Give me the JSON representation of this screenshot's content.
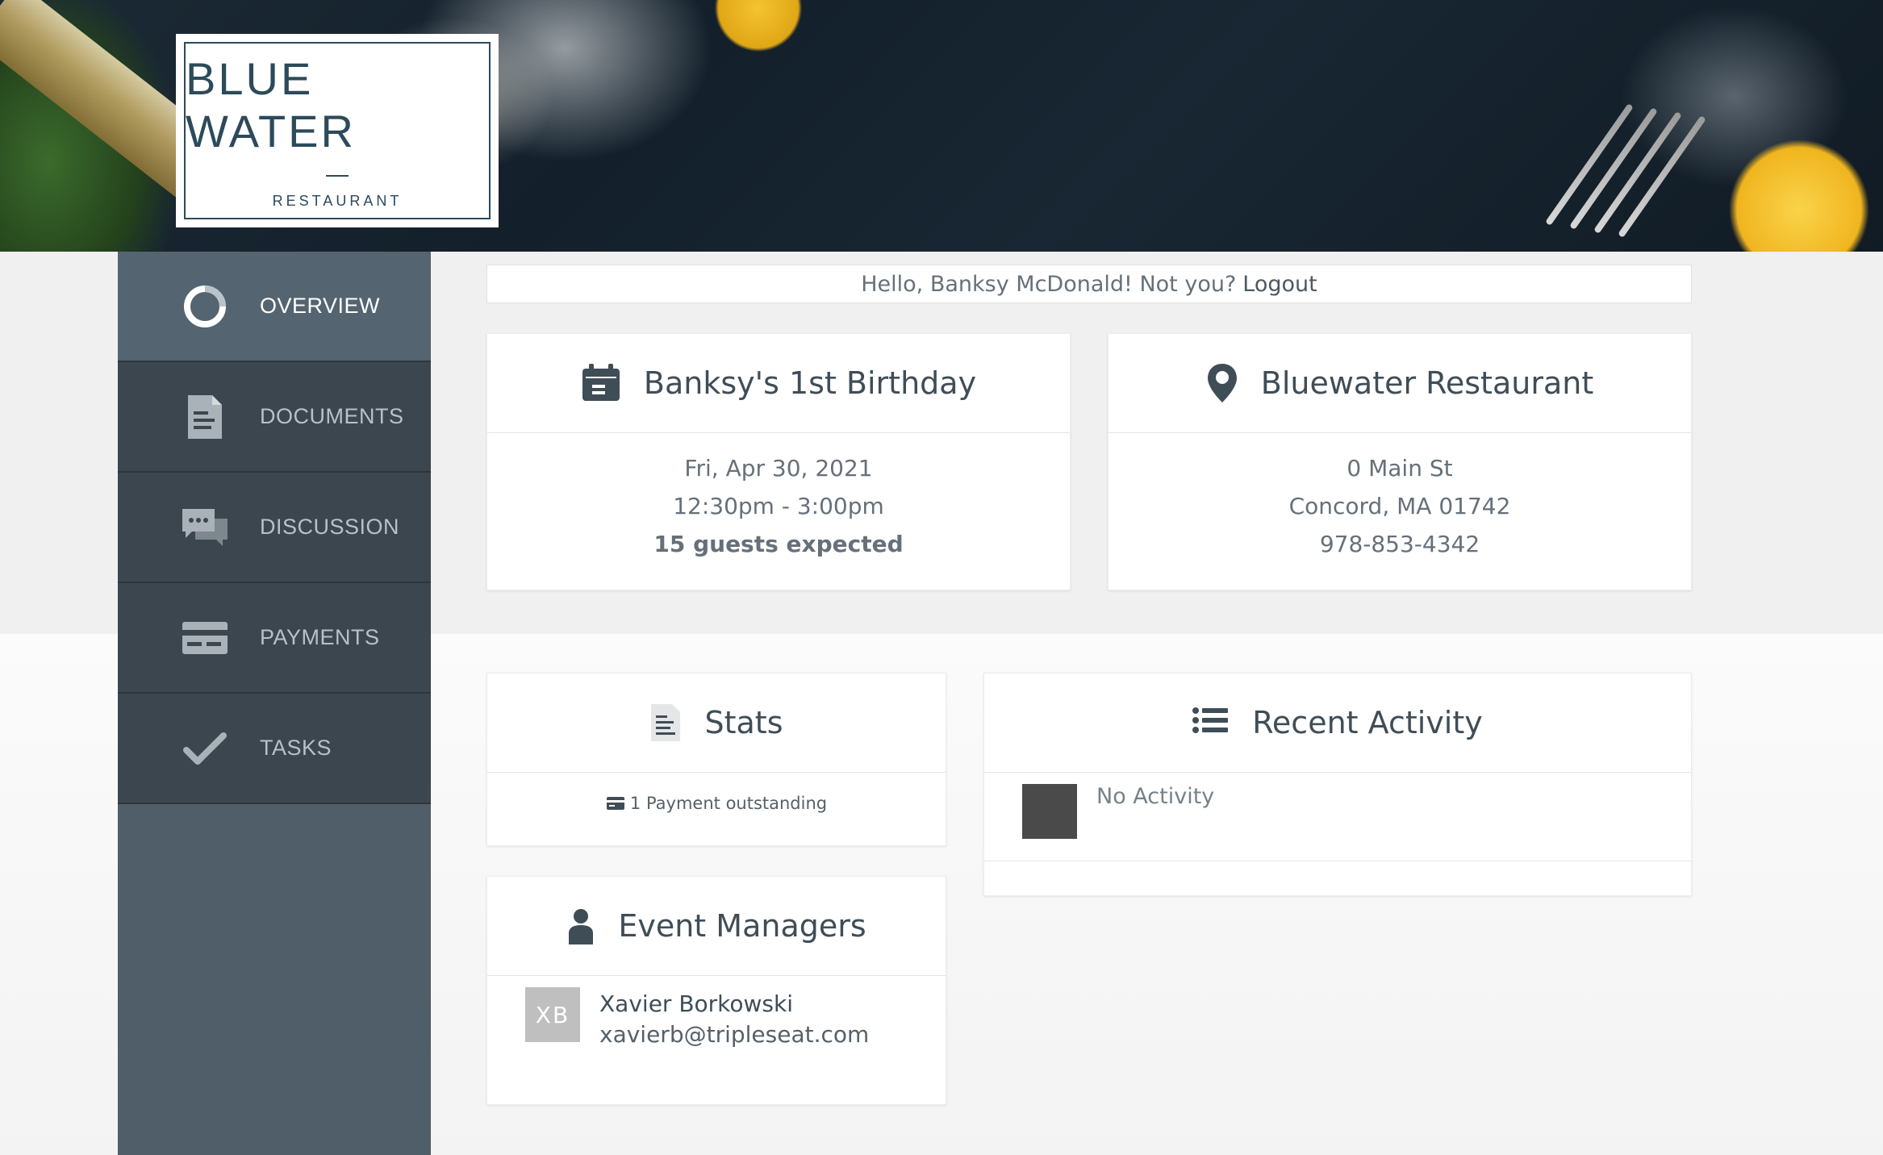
{
  "brand": {
    "title": "BLUE WATER",
    "subtitle": "RESTAURANT"
  },
  "colors": {
    "sidebar_bg": "#4f5e68",
    "sidebar_item": "#3c464e",
    "sidebar_active": "#546470",
    "text_dark": "#3f4d57",
    "text_muted": "#66707a"
  },
  "sidebar": {
    "items": [
      {
        "label": "OVERVIEW",
        "icon": "overview-ring-icon",
        "active": true
      },
      {
        "label": "DOCUMENTS",
        "icon": "document-icon",
        "active": false
      },
      {
        "label": "DISCUSSION",
        "icon": "chat-bubbles-icon",
        "active": false
      },
      {
        "label": "PAYMENTS",
        "icon": "credit-card-icon",
        "active": false
      },
      {
        "label": "TASKS",
        "icon": "checkmark-icon",
        "active": false
      }
    ]
  },
  "greeting": {
    "text": "Hello, Banksy McDonald! Not you?",
    "logout_label": "Logout"
  },
  "event": {
    "icon": "calendar-icon",
    "title": "Banksy's 1st Birthday",
    "date": "Fri, Apr 30, 2021",
    "time": "12:30pm - 3:00pm",
    "guests": "15 guests expected"
  },
  "location": {
    "icon": "map-pin-icon",
    "title": "Bluewater Restaurant",
    "street": "0 Main St",
    "city": "Concord, MA 01742",
    "phone": "978-853-4342"
  },
  "stats": {
    "icon": "document-icon",
    "title": "Stats",
    "payment_count": "1",
    "payment_label": "Payment",
    "payment_status": "outstanding"
  },
  "activity": {
    "icon": "list-icon",
    "title": "Recent Activity",
    "empty_text": "No Activity"
  },
  "managers": {
    "icon": "person-icon",
    "title": "Event Managers",
    "items": [
      {
        "initials": "XB",
        "name": "Xavier Borkowski",
        "email": "xavierb@tripleseat.com"
      }
    ]
  }
}
